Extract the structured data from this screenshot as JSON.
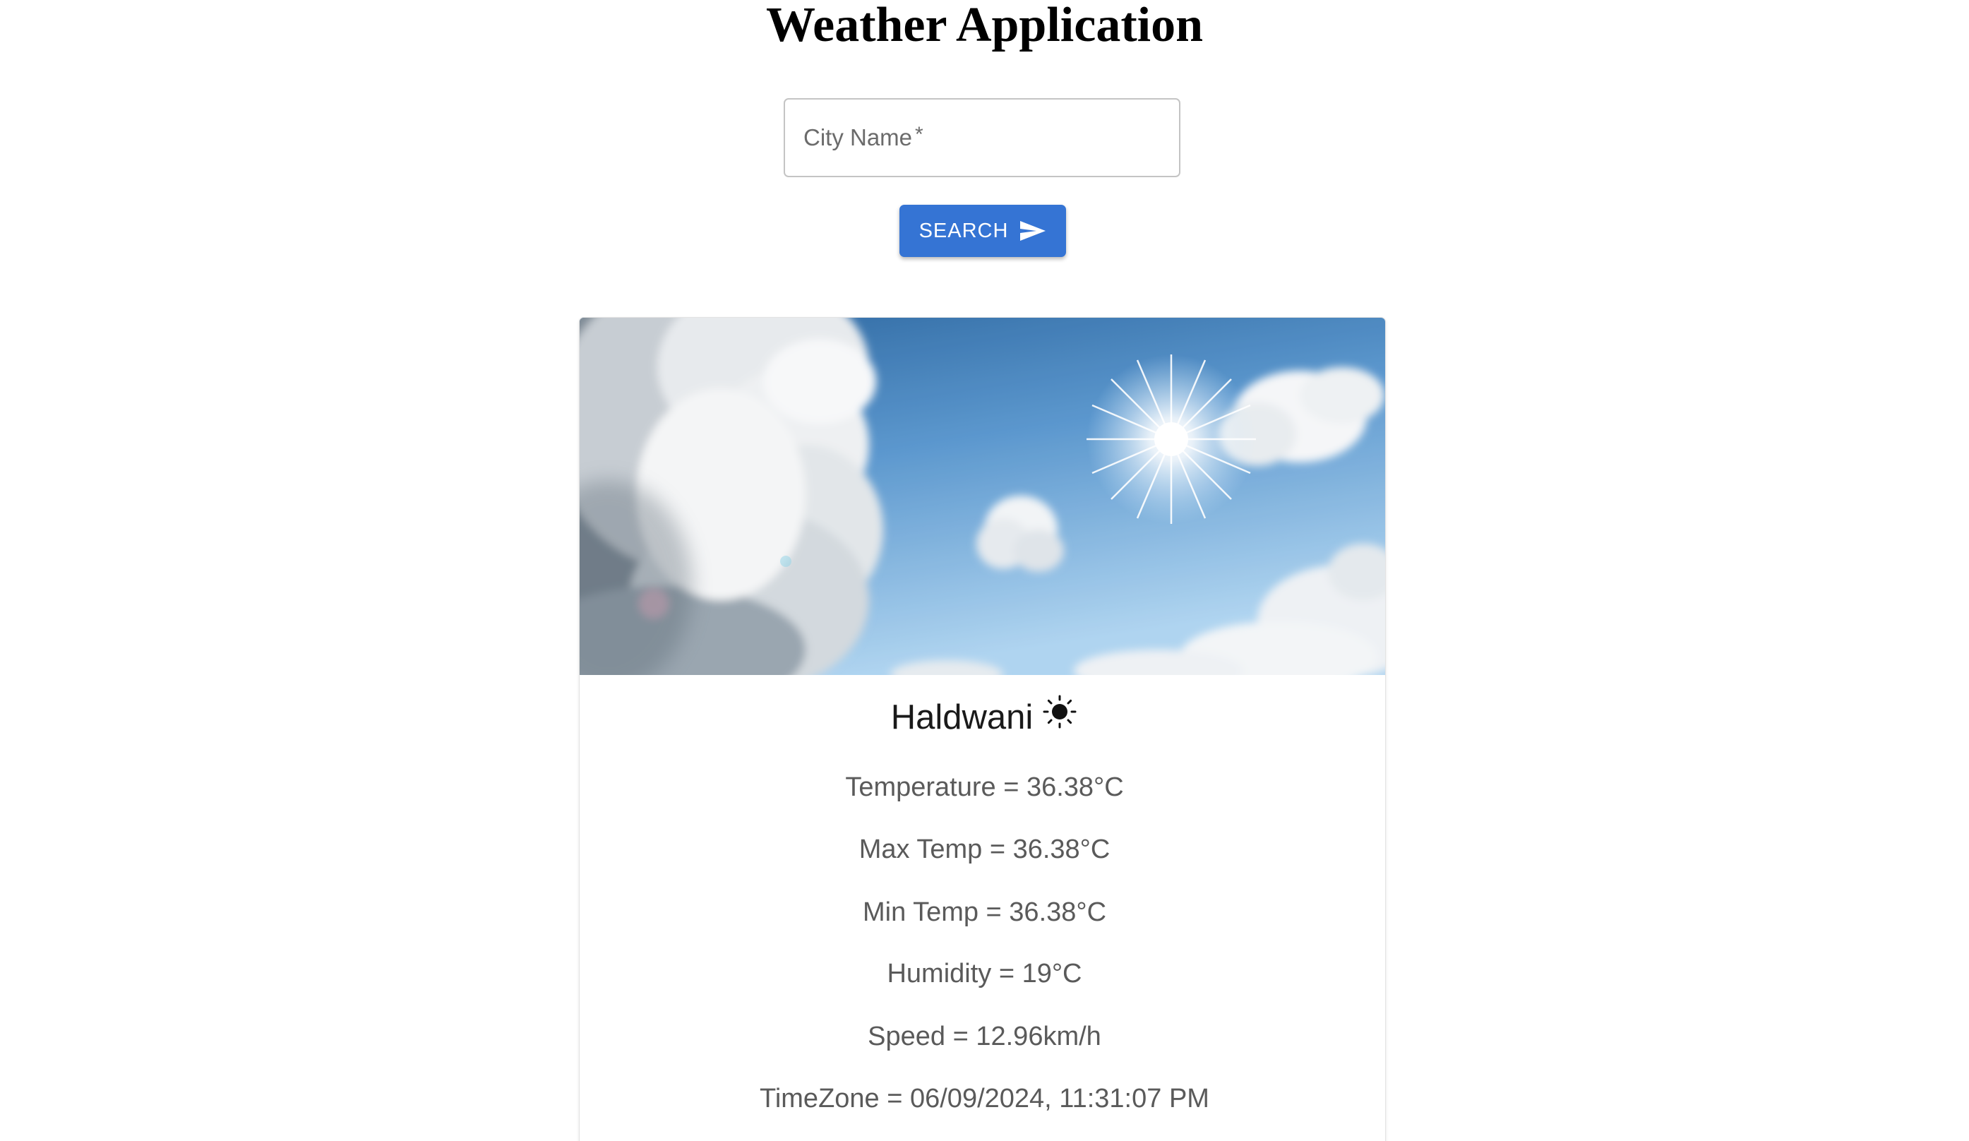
{
  "header": {
    "title": "Weather Application"
  },
  "search": {
    "placeholder": "City Name",
    "required_marker": "*",
    "value": "",
    "button_label": "SEARCH",
    "button_icon": "send-icon"
  },
  "colors": {
    "accent": "#3574d4",
    "sky_top": "#1f5f9c",
    "sky_bottom": "#a9d1ef"
  },
  "card": {
    "image": "sky-with-sun-and-clouds",
    "city": "Haldwani",
    "weather_icon": "sun-icon",
    "stats": [
      "Temperature = 36.38°C",
      "Max Temp = 36.38°C",
      "Min Temp = 36.38°C",
      "Humidity = 19°C",
      "Speed = 12.96km/h",
      "TimeZone = 06/09/2024, 11:31:07 PM"
    ]
  }
}
